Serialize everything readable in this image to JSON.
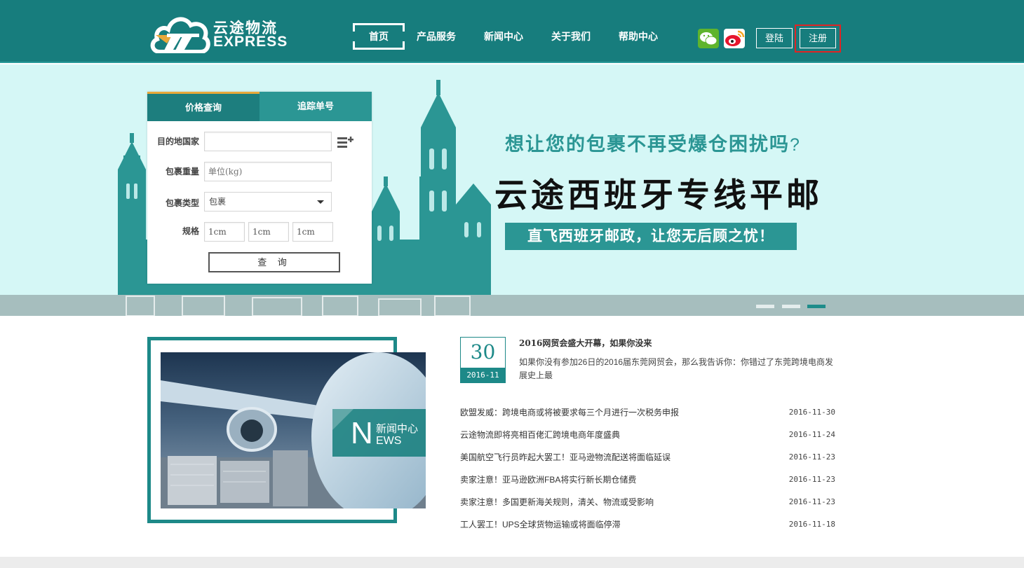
{
  "header": {
    "logo_cn": "云途物流",
    "logo_en": "EXPRESS",
    "nav": [
      {
        "label": "首页",
        "active": true
      },
      {
        "label": "产品服务",
        "active": false
      },
      {
        "label": "新闻中心",
        "active": false
      },
      {
        "label": "关于我们",
        "active": false
      },
      {
        "label": "帮助中心",
        "active": false
      }
    ],
    "social_icons": [
      "wechat-icon",
      "weibo-icon"
    ],
    "login_label": "登陆",
    "register_label": "注册"
  },
  "query_card": {
    "tabs": [
      "价格查询",
      "追踪单号"
    ],
    "destination_label": "目的地国家",
    "destination_value": "",
    "weight_label": "包裹重量",
    "weight_placeholder": "单位(kg)",
    "type_label": "包裹类型",
    "type_value": "包裹",
    "size_label": "规格",
    "size_values": [
      "1cm",
      "1cm",
      "1cm"
    ],
    "submit_label": "查 询"
  },
  "banner": {
    "headline": "想让您的包裹不再受爆仓困扰吗",
    "headline_mark": "?",
    "title": "云途西班牙专线平邮",
    "subtitle": "直飞西班牙邮政，让您无后顾之忧！",
    "slide_count": 3,
    "active_slide": 3
  },
  "news_block": {
    "badge_letter": "N",
    "badge_cn": "新闻中心",
    "badge_en": "EWS"
  },
  "featured": {
    "day": "30",
    "month": "2016-11",
    "title": "2016网贸会盛大开幕，如果你没来",
    "desc": "如果你没有参加26日的2016届东莞网贸会，那么我告诉你：你错过了东莞跨境电商发展史上最"
  },
  "news_list": [
    {
      "title": "欧盟发威：跨境电商或将被要求每三个月进行一次税务申报",
      "date": "2016-11-30"
    },
    {
      "title": "云途物流即将亮相百佬汇跨境电商年度盛典",
      "date": "2016-11-24"
    },
    {
      "title": "美国航空飞行员昨起大罢工！亚马逊物流配送将面临延误",
      "date": "2016-11-23"
    },
    {
      "title": "卖家注意！亚马逊欧洲FBA将实行新长期仓储费",
      "date": "2016-11-23"
    },
    {
      "title": "卖家注意！多国更新海关规则，清关、物流或受影响",
      "date": "2016-11-23"
    },
    {
      "title": "工人罢工！UPS全球货物运输或将面临停滞",
      "date": "2016-11-18"
    }
  ],
  "colors": {
    "header_bg": "#177d7d",
    "accent": "#2b9694",
    "banner_bg": "#d5f7f6",
    "highlight": "#e02424"
  }
}
